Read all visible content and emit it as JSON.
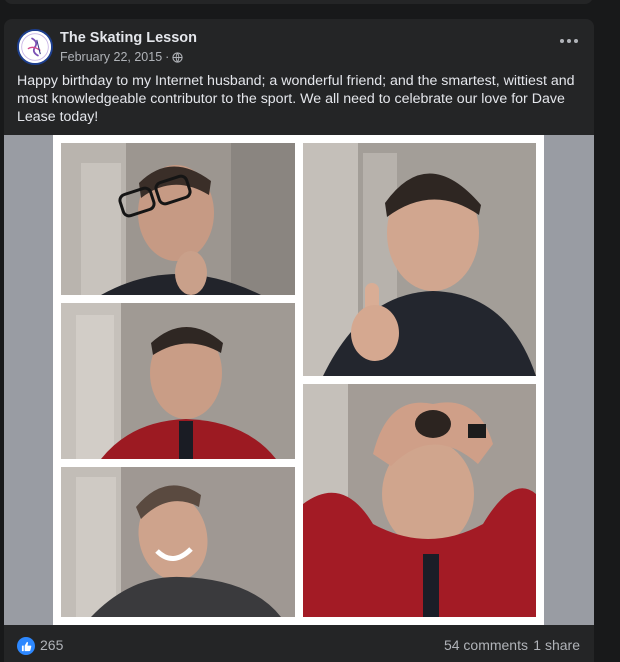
{
  "post": {
    "page_name": "The Skating Lesson",
    "date": "February 22, 2015",
    "separator": "·",
    "audience_icon": "globe-icon",
    "menu_icon": "more-horizontal-icon",
    "caption": "Happy birthday to my Internet husband; a wonderful friend; and the smartest, wittiest and most knowledgeable contributor to the sport. We all need to celebrate our love for Dave Lease today!"
  },
  "media": {
    "photos": [
      {
        "name": "photo-glasses-pose"
      },
      {
        "name": "photo-finger-raised"
      },
      {
        "name": "photo-red-shirt-portrait"
      },
      {
        "name": "photo-hands-on-head"
      },
      {
        "name": "photo-smiling"
      }
    ]
  },
  "reactions": {
    "icon": "like-icon",
    "count": "265",
    "comments": "54 comments",
    "shares": "1 share"
  },
  "colors": {
    "background": "#18191a",
    "card": "#242526",
    "text_primary": "#e4e6eb",
    "text_secondary": "#b0b3b8",
    "like_blue": "#2d88ff"
  }
}
